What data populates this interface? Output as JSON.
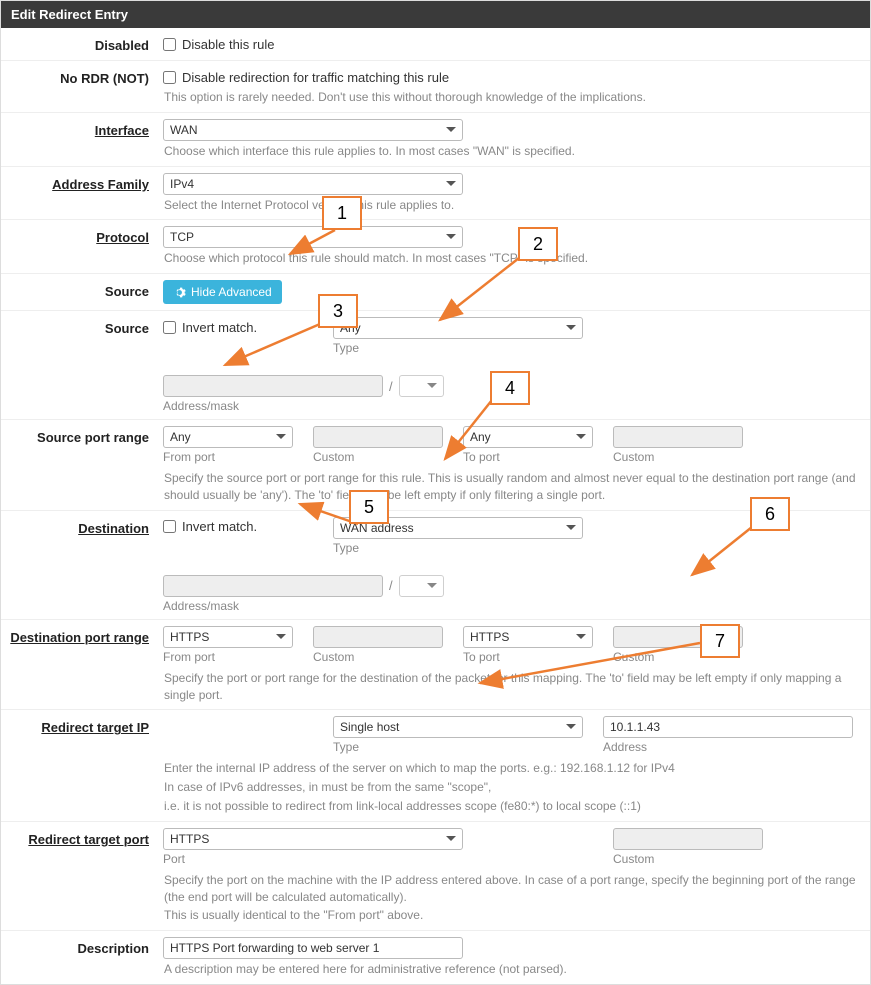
{
  "panel_title": "Edit Redirect Entry",
  "disabled": {
    "label": "Disabled",
    "text": "Disable this rule"
  },
  "nordr": {
    "label": "No RDR (NOT)",
    "text": "Disable redirection for traffic matching this rule",
    "help": "This option is rarely needed. Don't use this without thorough knowledge of the implications."
  },
  "interface": {
    "label": "Interface",
    "value": "WAN",
    "help": "Choose which interface this rule applies to. In most cases \"WAN\" is specified."
  },
  "address_family": {
    "label": "Address Family",
    "value": "IPv4",
    "help": "Select the Internet Protocol version this rule applies to."
  },
  "protocol": {
    "label": "Protocol",
    "value": "TCP",
    "help": "Choose which protocol this rule should match. In most cases \"TCP\" is specified."
  },
  "source_btn": {
    "label": "Source",
    "btn": "Hide Advanced"
  },
  "source": {
    "label": "Source",
    "invert": "Invert match.",
    "type": "Any",
    "type_label": "Type",
    "mask_label": "Address/mask"
  },
  "src_port": {
    "label": "Source port range",
    "from": "Any",
    "to": "Any",
    "from_label": "From port",
    "to_label": "To port",
    "custom_label": "Custom",
    "help": "Specify the source port or port range for this rule. This is usually random and almost never equal to the destination port range (and should usually be 'any'). The 'to' field may be left empty if only filtering a single port."
  },
  "destination": {
    "label": "Destination",
    "invert": "Invert match.",
    "type": "WAN address",
    "type_label": "Type",
    "mask_label": "Address/mask"
  },
  "dst_port": {
    "label": "Destination port range",
    "from": "HTTPS",
    "to": "HTTPS",
    "from_label": "From port",
    "to_label": "To port",
    "custom_label": "Custom",
    "help": "Specify the port or port range for the destination of the packet for this mapping. The 'to' field may be left empty if only mapping a single port."
  },
  "redirect_ip": {
    "label": "Redirect target IP",
    "type": "Single host",
    "type_label": "Type",
    "address": "10.1.1.43",
    "address_label": "Address",
    "help1": "Enter the internal IP address of the server on which to map the ports. e.g.: 192.168.1.12 for IPv4",
    "help2": "In case of IPv6 addresses, in must be from the same \"scope\",",
    "help3": "i.e. it is not possible to redirect from link-local addresses scope (fe80:*) to local scope (::1)"
  },
  "redirect_port": {
    "label": "Redirect target port",
    "port": "HTTPS",
    "port_label": "Port",
    "custom_label": "Custom",
    "help1": "Specify the port on the machine with the IP address entered above. In case of a port range, specify the beginning port of the range (the end port will be calculated automatically).",
    "help2": "This is usually identical to the \"From port\" above."
  },
  "description": {
    "label": "Description",
    "value": "HTTPS Port forwarding to web server 1",
    "help": "A description may be entered here for administrative reference (not parsed)."
  },
  "callouts": {
    "n1": "1",
    "n2": "2",
    "n3": "3",
    "n4": "4",
    "n5": "5",
    "n6": "6",
    "n7": "7"
  }
}
